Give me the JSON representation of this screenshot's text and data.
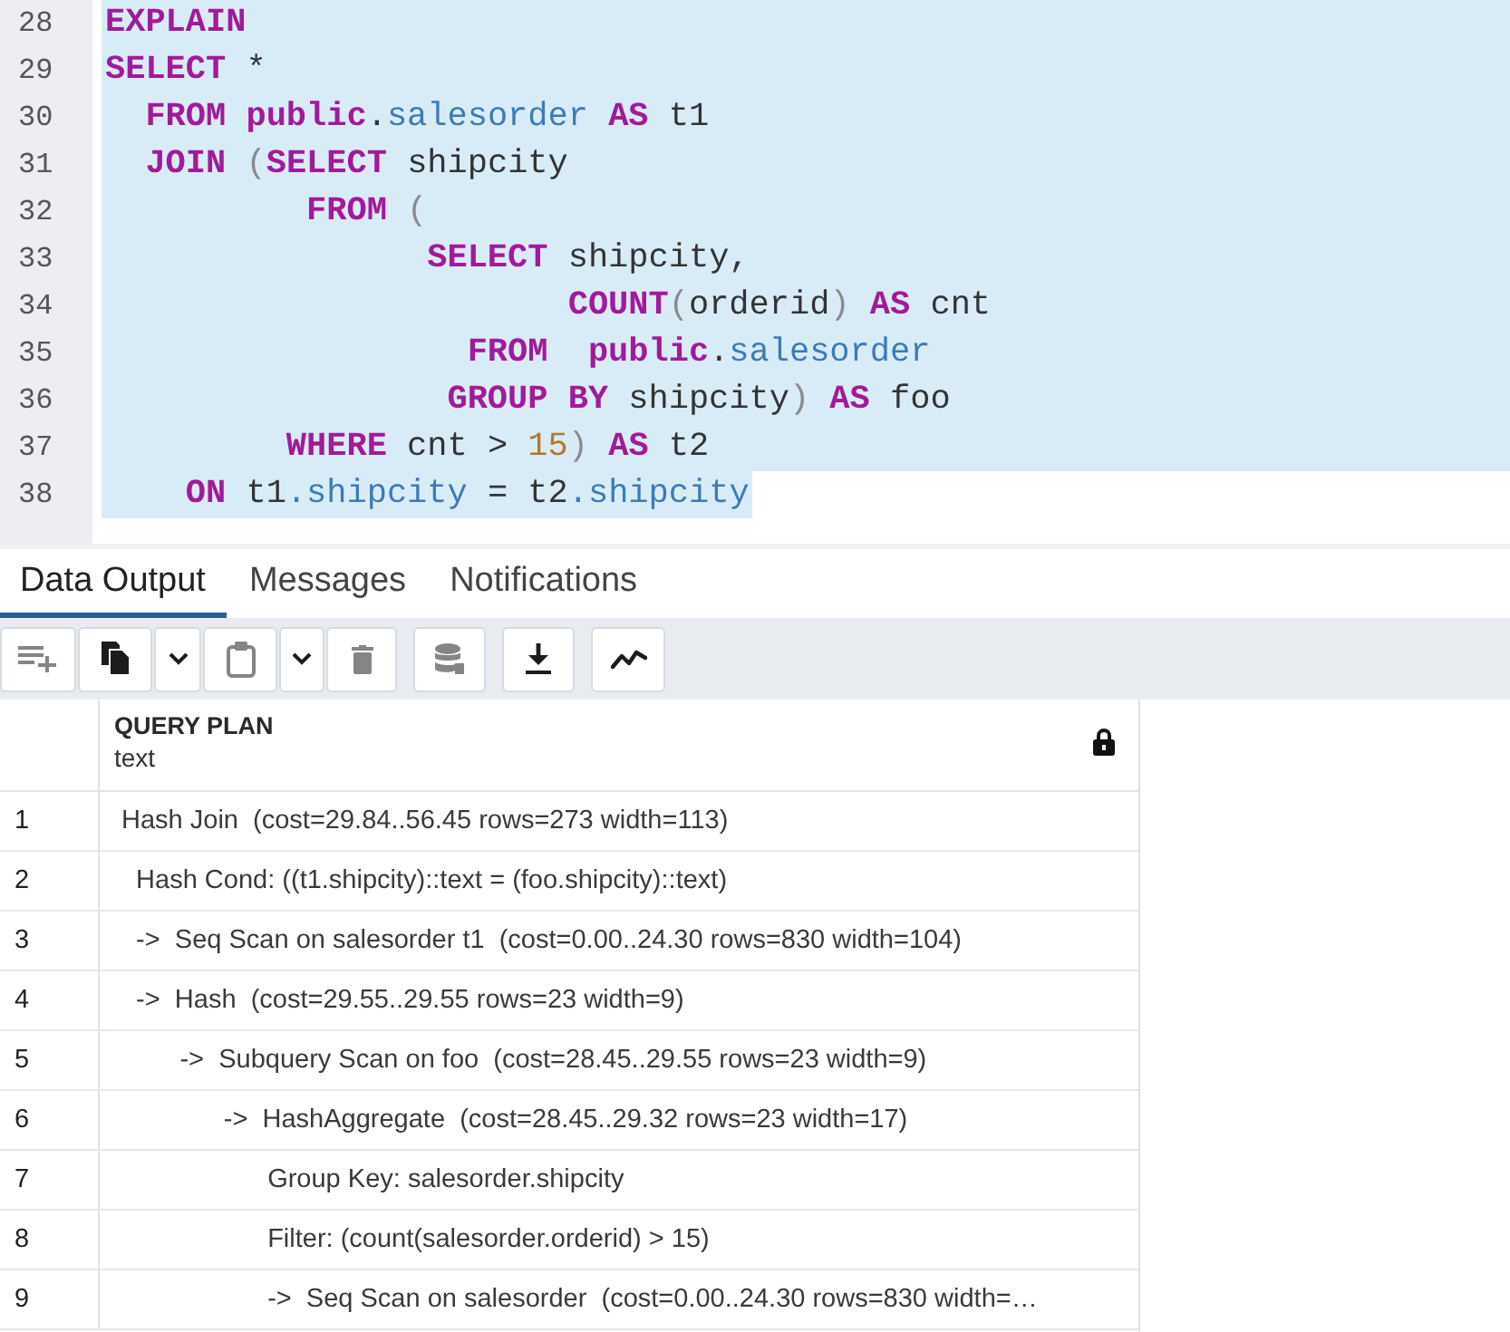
{
  "editor": {
    "lines": [
      {
        "number": "28",
        "selected": true,
        "selection_end": false,
        "tokens": [
          {
            "kind": "keyword",
            "text": "EXPLAIN"
          }
        ]
      },
      {
        "number": "29",
        "selected": true,
        "selection_end": false,
        "tokens": [
          {
            "kind": "keyword",
            "text": "SELECT"
          },
          {
            "kind": "plain",
            "text": " *"
          }
        ]
      },
      {
        "number": "30",
        "selected": true,
        "selection_end": false,
        "tokens": [
          {
            "kind": "keyword",
            "text": "  FROM public"
          },
          {
            "kind": "plain",
            "text": "."
          },
          {
            "kind": "property",
            "text": "salesorder"
          },
          {
            "kind": "keyword",
            "text": " AS"
          },
          {
            "kind": "plain",
            "text": " t1"
          }
        ]
      },
      {
        "number": "31",
        "selected": true,
        "selection_end": false,
        "tokens": [
          {
            "kind": "keyword",
            "text": "  JOIN"
          },
          {
            "kind": "punct",
            "text": " ("
          },
          {
            "kind": "keyword",
            "text": "SELECT"
          },
          {
            "kind": "plain",
            "text": " shipcity"
          }
        ]
      },
      {
        "number": "32",
        "selected": true,
        "selection_end": false,
        "tokens": [
          {
            "kind": "keyword",
            "text": "          FROM"
          },
          {
            "kind": "punct",
            "text": " ("
          }
        ]
      },
      {
        "number": "33",
        "selected": true,
        "selection_end": false,
        "tokens": [
          {
            "kind": "keyword",
            "text": "                SELECT"
          },
          {
            "kind": "plain",
            "text": " shipcity,"
          }
        ]
      },
      {
        "number": "34",
        "selected": true,
        "selection_end": false,
        "tokens": [
          {
            "kind": "keyword",
            "text": "                       COUNT"
          },
          {
            "kind": "punct",
            "text": "("
          },
          {
            "kind": "plain",
            "text": "orderid"
          },
          {
            "kind": "punct",
            "text": ")"
          },
          {
            "kind": "keyword",
            "text": " AS"
          },
          {
            "kind": "plain",
            "text": " cnt"
          }
        ]
      },
      {
        "number": "35",
        "selected": true,
        "selection_end": false,
        "tokens": [
          {
            "kind": "keyword",
            "text": "                  FROM  public"
          },
          {
            "kind": "plain",
            "text": "."
          },
          {
            "kind": "property",
            "text": "salesorder"
          }
        ]
      },
      {
        "number": "36",
        "selected": true,
        "selection_end": false,
        "tokens": [
          {
            "kind": "keyword",
            "text": "                 GROUP BY"
          },
          {
            "kind": "plain",
            "text": " shipcity"
          },
          {
            "kind": "punct",
            "text": ")"
          },
          {
            "kind": "keyword",
            "text": " AS"
          },
          {
            "kind": "plain",
            "text": " foo"
          }
        ]
      },
      {
        "number": "37",
        "selected": true,
        "selection_end": false,
        "tokens": [
          {
            "kind": "keyword",
            "text": "         WHERE"
          },
          {
            "kind": "plain",
            "text": " cnt > "
          },
          {
            "kind": "number",
            "text": "15"
          },
          {
            "kind": "punct",
            "text": ")"
          },
          {
            "kind": "keyword",
            "text": " AS"
          },
          {
            "kind": "plain",
            "text": " t2"
          }
        ]
      },
      {
        "number": "38",
        "selected": true,
        "selection_end": true,
        "tokens": [
          {
            "kind": "keyword",
            "text": "    ON"
          },
          {
            "kind": "plain",
            "text": " t1"
          },
          {
            "kind": "property",
            "text": ".shipcity"
          },
          {
            "kind": "plain",
            "text": " = t2"
          },
          {
            "kind": "property",
            "text": ".shipcity"
          }
        ]
      }
    ]
  },
  "output_tabs": [
    {
      "label": "Data Output",
      "selected": true
    },
    {
      "label": "Messages",
      "selected": false
    },
    {
      "label": "Notifications",
      "selected": false
    }
  ],
  "toolbar": {
    "groups": [
      {
        "buttons": [
          {
            "kind": "add_row",
            "disabled": true
          },
          {
            "kind": "copy",
            "disabled": false
          },
          {
            "kind": "copy_menu",
            "disabled": false
          },
          {
            "kind": "paste",
            "disabled": true
          },
          {
            "kind": "paste_menu",
            "disabled": false
          },
          {
            "kind": "delete",
            "disabled": true
          }
        ]
      },
      {
        "buttons": [
          {
            "kind": "save_data",
            "disabled": true
          }
        ]
      },
      {
        "buttons": [
          {
            "kind": "download",
            "disabled": false
          }
        ]
      },
      {
        "buttons": [
          {
            "kind": "graph",
            "disabled": false
          }
        ]
      }
    ]
  },
  "result_grid": {
    "columns": [
      {
        "name": "QUERY PLAN",
        "type": "text",
        "locked": true
      }
    ],
    "rows": [
      {
        "number": "1",
        "cells": [
          "Hash Join  (cost=29.84..56.45 rows=273 width=113)"
        ]
      },
      {
        "number": "2",
        "cells": [
          "  Hash Cond: ((t1.shipcity)::text = (foo.shipcity)::text)"
        ]
      },
      {
        "number": "3",
        "cells": [
          "  ->  Seq Scan on salesorder t1  (cost=0.00..24.30 rows=830 width=104)"
        ]
      },
      {
        "number": "4",
        "cells": [
          "  ->  Hash  (cost=29.55..29.55 rows=23 width=9)"
        ]
      },
      {
        "number": "5",
        "cells": [
          "        ->  Subquery Scan on foo  (cost=28.45..29.55 rows=23 width=9)"
        ]
      },
      {
        "number": "6",
        "cells": [
          "              ->  HashAggregate  (cost=28.45..29.32 rows=23 width=17)"
        ]
      },
      {
        "number": "7",
        "cells": [
          "                    Group Key: salesorder.shipcity"
        ]
      },
      {
        "number": "8",
        "cells": [
          "                    Filter: (count(salesorder.orderid) > 15)"
        ]
      },
      {
        "number": "9",
        "cells": [
          "                    ->  Seq Scan on salesorder  (cost=0.00..24.30 rows=830 width=…"
        ]
      }
    ]
  }
}
